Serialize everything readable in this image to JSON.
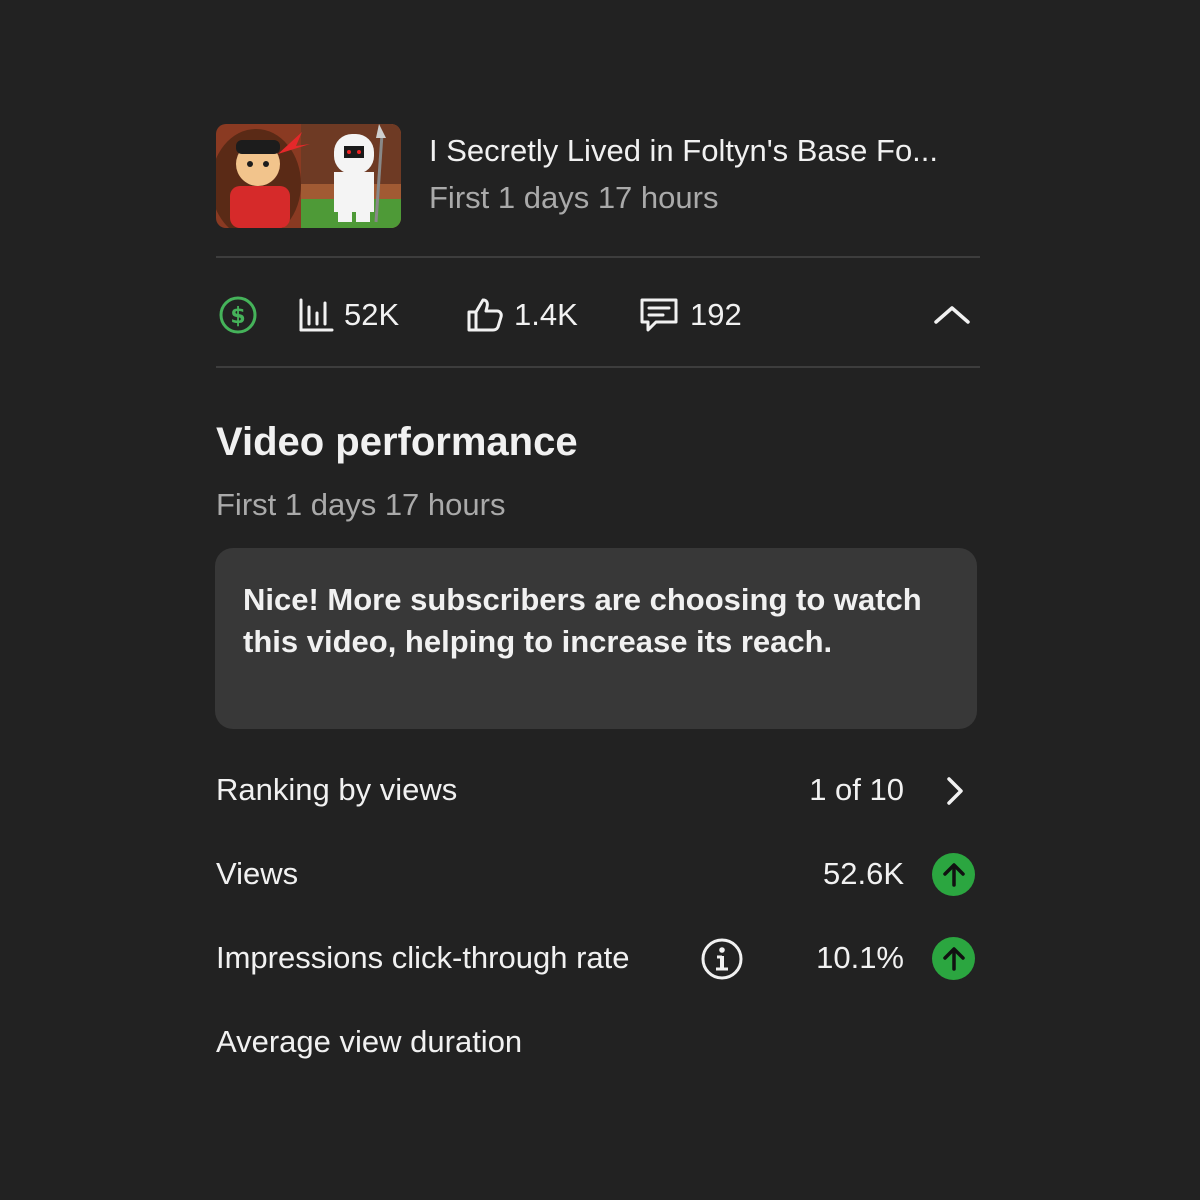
{
  "video": {
    "title": "I Secretly Lived in Foltyn's Base Fo...",
    "period": "First 1 days 17 hours"
  },
  "stats": {
    "views": "52K",
    "likes": "1.4K",
    "comments": "192"
  },
  "performance": {
    "title": "Video performance",
    "period": "First 1 days 17 hours",
    "insight": "Nice! More subscribers are choosing to watch this video, helping to increase its reach.",
    "rows": [
      {
        "label": "Ranking by views",
        "value": "1 of 10"
      },
      {
        "label": "Views",
        "value": "52.6K",
        "trend": "up"
      },
      {
        "label": "Impressions click-through rate",
        "value": "10.1%",
        "trend": "up"
      },
      {
        "label": "Average view duration"
      }
    ]
  },
  "colors": {
    "background": "#222222",
    "card": "#383838",
    "accent_green": "#2ba640",
    "monetization_green": "#45b35a",
    "secondary_text": "#aaaaaa"
  },
  "icons": {
    "monetization": "dollar-circle-icon",
    "views": "bar-chart-icon",
    "likes": "thumbs-up-icon",
    "comments": "comment-icon",
    "collapse": "chevron-up-icon",
    "ranking": "chevron-right-icon",
    "info": "info-icon",
    "trend": "arrow-up-icon"
  }
}
